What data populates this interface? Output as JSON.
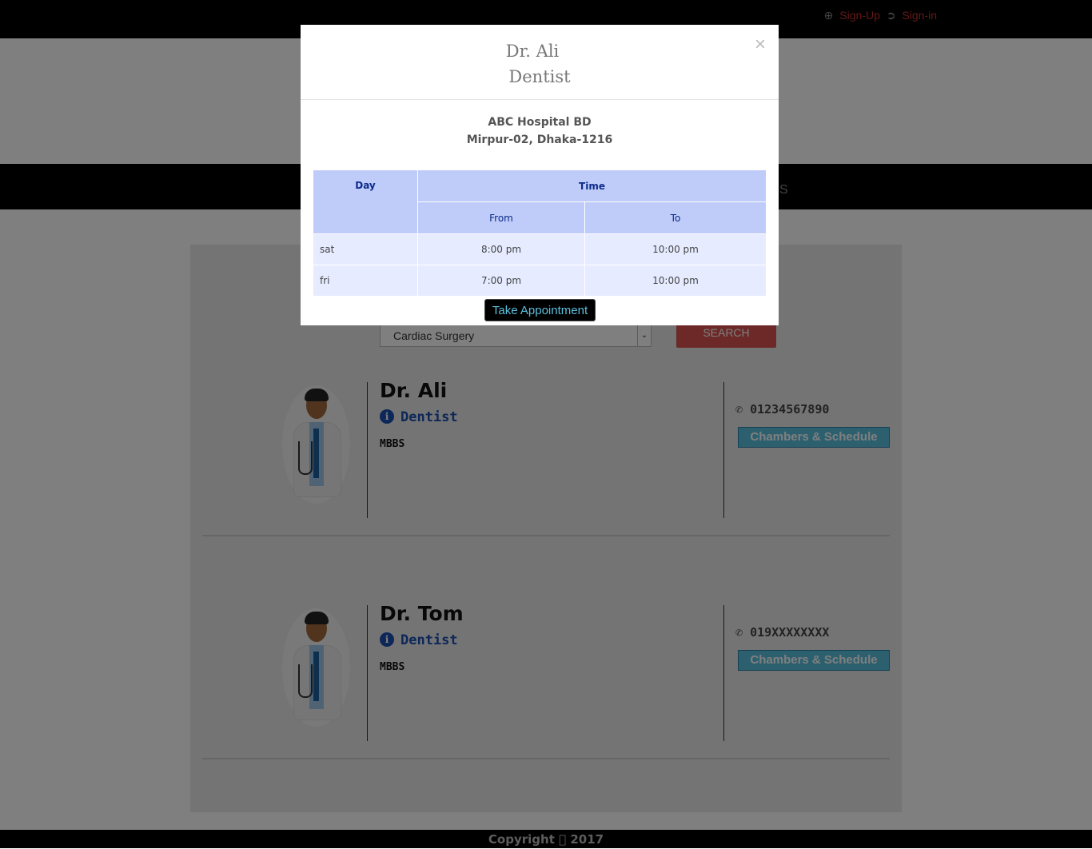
{
  "top_links": {
    "signup": "Sign-Up",
    "signin": "Sign-in"
  },
  "nav": {
    "partial_label": "S"
  },
  "search": {
    "selected": "Cardiac Surgery",
    "button": "SEARCH"
  },
  "doctors": [
    {
      "name": "Dr. Ali",
      "specialty": "Dentist",
      "degree": "MBBS",
      "phone": "01234567890",
      "button": "Chambers & Schedule"
    },
    {
      "name": "Dr. Tom",
      "specialty": "Dentist",
      "degree": "MBBS",
      "phone": "019XXXXXXXX",
      "button": "Chambers & Schedule"
    }
  ],
  "footer": "Copyright \u0000 2017",
  "modal": {
    "name": "Dr. Ali",
    "specialty": "Dentist",
    "close": "×",
    "hospital": "ABC Hospital BD",
    "address": "Mirpur-02, Dhaka-1216",
    "table": {
      "day_header": "Day",
      "time_header": "Time",
      "from_header": "From",
      "to_header": "To",
      "rows": [
        {
          "day": "sat",
          "from": "8:00 pm",
          "to": "10:00 pm"
        },
        {
          "day": "fri",
          "from": "7:00 pm",
          "to": "10:00 pm"
        }
      ]
    },
    "appointment_button": "Take Appointment"
  }
}
